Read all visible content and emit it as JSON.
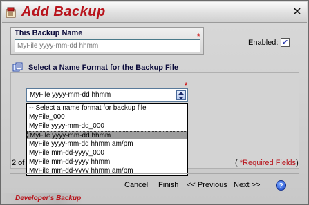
{
  "window": {
    "title": "Add  Backup",
    "close_label": "✕"
  },
  "name_section": {
    "label": "This Backup Name",
    "required_mark": "*",
    "input_placeholder": "MyFile yyyy-mm-dd hhmm",
    "enabled_label": "Enabled:",
    "enabled_checked": true,
    "check_glyph": "✔"
  },
  "format_section": {
    "title": "Select a Name Format for the Backup File",
    "required_mark": "*",
    "selected_value": "MyFile yyyy-mm-dd hhmm",
    "options": [
      "-- Select a name format for backup file",
      "MyFile_000",
      "MyFile yyyy-mm-dd_000",
      "MyFile yyyy-mm-dd hhmm",
      "MyFile yyyy-mm-dd hhmm am/pm",
      "MyFile mm-dd-yyyy_000",
      "MyFile mm-dd-yyyy hhmm",
      "MyFile mm-dd-yyyy hhmm am/pm"
    ],
    "highlighted_index": 3
  },
  "footer": {
    "page_indicator": "2 of",
    "required_note_open": "(",
    "required_note_star": "*",
    "required_note_text": "Required Fields",
    "required_note_close": ")",
    "cancel_label": "Cancel",
    "finish_label": "Finish",
    "previous_label": "<< Previous",
    "next_label": "Next >>",
    "help_label": "?"
  },
  "brand": {
    "text": "Developer's Backup"
  },
  "colors": {
    "title_red": "#b8141c",
    "required_red": "#cc0000",
    "selection_gray": "#9c9c9c"
  },
  "icons": {
    "title": "backup-icon",
    "section": "documents-icon",
    "help": "help-icon",
    "combo_arrow": "updown-arrow-icon"
  }
}
